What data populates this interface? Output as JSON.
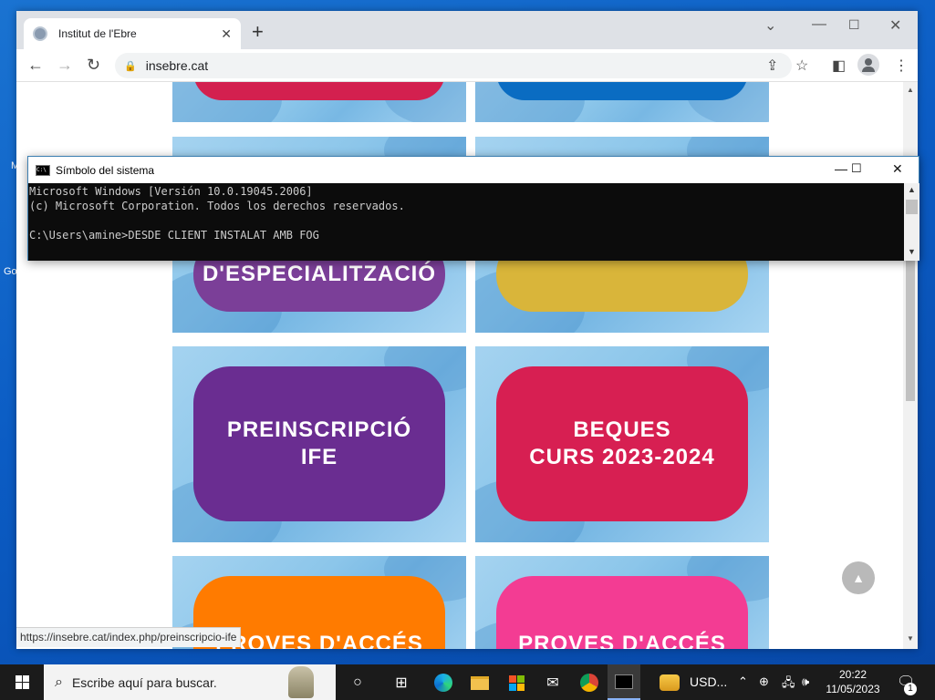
{
  "desktop": {
    "fragments": [
      "M",
      "Go"
    ]
  },
  "browser": {
    "tab_title": "Institut de l'Ebre",
    "url": "insebre.cat",
    "status_url": "https://insebre.cat/index.php/preinscripcio-ife",
    "tiles": [
      {
        "text": "",
        "color": "#d3204f"
      },
      {
        "text": "",
        "color": "#0a6cc2"
      },
      {
        "text": "D'ESPECIALITZACIÓ",
        "color": "#7b3f98"
      },
      {
        "text": "",
        "color": "#d9b53a"
      },
      {
        "text": "PREINSCRIPCIÓ\nIFE",
        "color": "#6a2d91"
      },
      {
        "text": "BEQUES\nCURS 2023-2024",
        "color": "#d71f52"
      },
      {
        "text": "PROVES D'ACCÉS",
        "color": "#ff7b00"
      },
      {
        "text": "PROVES D'ACCÉS",
        "color": "#f33c93"
      }
    ]
  },
  "cmd": {
    "title": "Símbolo del sistema",
    "lines": [
      "Microsoft Windows [Versión 10.0.19045.2006]",
      "(c) Microsoft Corporation. Todos los derechos reservados.",
      "",
      "C:\\Users\\amine>DESDE CLIENT INSTALAT AMB FOG"
    ]
  },
  "taskbar": {
    "search_placeholder": "Escribe aquí para buscar.",
    "weather_label": "USD...",
    "time": "20:22",
    "date": "11/05/2023",
    "notification_count": "1"
  }
}
